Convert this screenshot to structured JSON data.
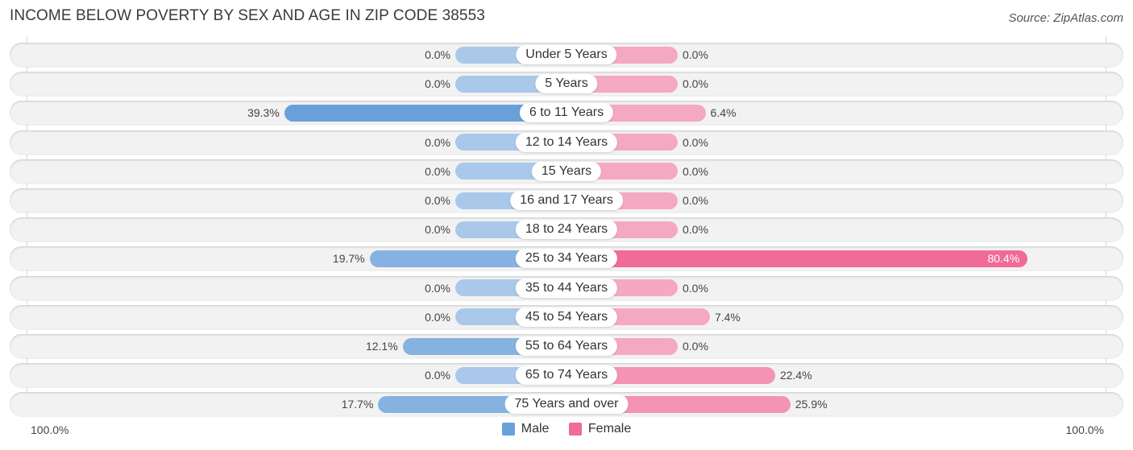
{
  "chart_data": {
    "type": "bar",
    "orientation": "horizontal-diverging",
    "title": "INCOME BELOW POVERTY BY SEX AND AGE IN ZIP CODE 38553",
    "source": "Source: ZipAtlas.com",
    "categories": [
      "Under 5 Years",
      "5 Years",
      "6 to 11 Years",
      "12 to 14 Years",
      "15 Years",
      "16 and 17 Years",
      "18 to 24 Years",
      "25 to 34 Years",
      "35 to 44 Years",
      "45 to 54 Years",
      "55 to 64 Years",
      "65 to 74 Years",
      "75 Years and over"
    ],
    "series": [
      {
        "name": "Male",
        "color": "#6aa0da",
        "values": [
          0.0,
          0.0,
          39.3,
          0.0,
          0.0,
          0.0,
          0.0,
          19.7,
          0.0,
          0.0,
          12.1,
          0.0,
          17.7
        ],
        "labels": [
          "0.0%",
          "0.0%",
          "39.3%",
          "0.0%",
          "0.0%",
          "0.0%",
          "0.0%",
          "19.7%",
          "0.0%",
          "0.0%",
          "12.1%",
          "0.0%",
          "17.7%"
        ]
      },
      {
        "name": "Female",
        "color": "#f06b95",
        "values": [
          0.0,
          0.0,
          6.4,
          0.0,
          0.0,
          0.0,
          0.0,
          80.4,
          0.0,
          7.4,
          0.0,
          22.4,
          25.9
        ],
        "labels": [
          "0.0%",
          "0.0%",
          "6.4%",
          "0.0%",
          "0.0%",
          "0.0%",
          "0.0%",
          "80.4%",
          "0.0%",
          "7.4%",
          "0.0%",
          "22.4%",
          "25.9%"
        ]
      }
    ],
    "xlim": [
      -100,
      100
    ],
    "axis_labels": {
      "left": "100.0%",
      "right": "100.0%"
    },
    "legend": {
      "position": "bottom-center",
      "items": [
        "Male",
        "Female"
      ]
    },
    "colors": {
      "male_light": "#a9c8ea",
      "male_strong": "#6aa0da",
      "female_light": "#f5a8c2",
      "female_strong": "#f06b95"
    }
  }
}
